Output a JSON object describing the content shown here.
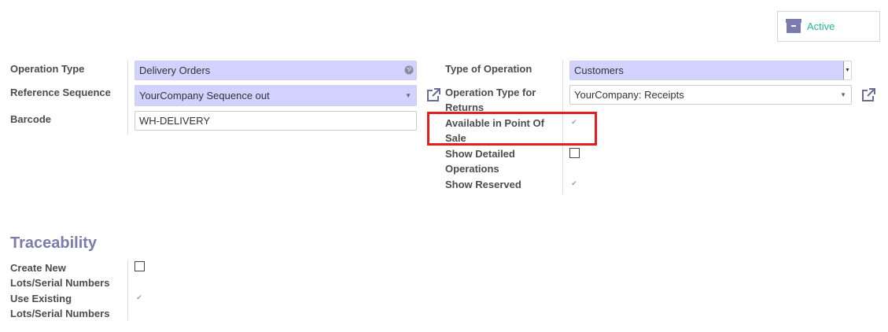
{
  "status_button": {
    "label": "Active",
    "icon": "archive-icon",
    "color": "#21b799"
  },
  "left": {
    "operation_type": {
      "label": "Operation Type",
      "value": "Delivery Orders"
    },
    "reference_sequence": {
      "label": "Reference Sequence",
      "value": "YourCompany Sequence out"
    },
    "barcode": {
      "label": "Barcode",
      "value": "WH-DELIVERY"
    }
  },
  "right": {
    "type_of_operation": {
      "label": "Type of Operation",
      "value": "Customers"
    },
    "return_type": {
      "label_line1": "Operation Type for",
      "label_line2": "Returns",
      "value": "YourCompany: Receipts"
    },
    "available_pos": {
      "label_line1": "Available in Point Of",
      "label_line2": "Sale",
      "checked": true
    },
    "show_detailed": {
      "label_line1": "Show Detailed",
      "label_line2": "Operations",
      "checked": false
    },
    "show_reserved": {
      "label": "Show Reserved",
      "checked": true
    }
  },
  "traceability": {
    "title": "Traceability",
    "create_new": {
      "label_line1": "Create New",
      "label_line2": "Lots/Serial Numbers",
      "checked": false
    },
    "use_existing": {
      "label_line1": "Use Existing",
      "label_line2": "Lots/Serial Numbers",
      "checked": true
    }
  },
  "colors": {
    "required_bg": "#d2d2ff",
    "section_title": "#7c7bad",
    "highlight": "#e41e1e"
  }
}
